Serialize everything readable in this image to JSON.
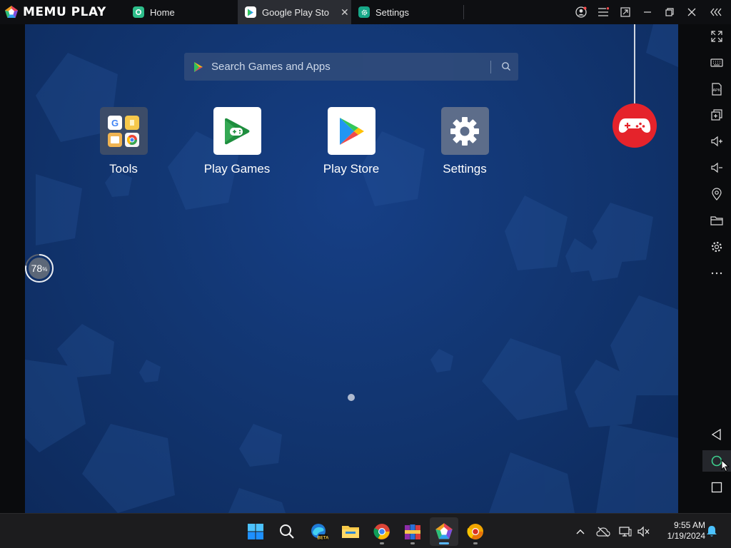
{
  "titlebar": {
    "brand": "MEMU PLAY",
    "tabs": [
      {
        "label": "Home",
        "icon": "memu-home-icon"
      },
      {
        "label": "Google Play Store",
        "icon": "play-store-tab-icon",
        "active": true
      },
      {
        "label": "Settings",
        "icon": "settings-tab-icon"
      }
    ],
    "controls": [
      "account-icon",
      "menu-icon",
      "screen-mode-icon",
      "minimize-icon",
      "restore-icon",
      "close-icon",
      "collapse-toolbar-icon"
    ]
  },
  "search": {
    "placeholder": "Search Games and Apps"
  },
  "apps": [
    {
      "label": "Tools",
      "icon": "tools-folder-icon"
    },
    {
      "label": "Play Games",
      "icon": "play-games-icon"
    },
    {
      "label": "Play Store",
      "icon": "play-store-icon"
    },
    {
      "label": "Settings",
      "icon": "settings-gear-icon"
    }
  ],
  "perf_monitor": {
    "value": "78",
    "unit": "%",
    "level": 0.78
  },
  "side_toolbar": [
    "fullscreen-icon",
    "keyboard-icon",
    "apk-icon",
    "multi-instance-icon",
    "volume-up-icon",
    "volume-down-icon",
    "location-icon",
    "folder-icon",
    "settings-icon",
    "more-icon",
    "back-icon",
    "home-icon",
    "recents-icon"
  ],
  "taskbar": {
    "apps": [
      "windows-start-icon",
      "search-icon",
      "edge-beta-icon",
      "file-explorer-icon",
      "chrome-icon",
      "winrar-icon",
      "memu-icon",
      "chrome-canary-icon"
    ],
    "tray": [
      "chevron-up-icon",
      "network-offline-icon",
      "display-icon",
      "volume-muted-icon",
      "notification-bell-icon"
    ],
    "time": "9:55 AM",
    "date": "1/19/2024"
  },
  "colors": {
    "screen_bg": "#123672",
    "gamepad": "#e5232b",
    "taskbar": "#1c1c1e",
    "accent": "#3ecf8e"
  }
}
